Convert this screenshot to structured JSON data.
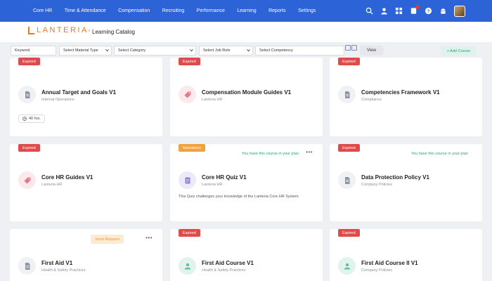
{
  "nav": {
    "items": [
      "Core HR",
      "Time & Attendance",
      "Compensation",
      "Recruiting",
      "Performance",
      "Learning",
      "Reports",
      "Settings"
    ],
    "accent": "#2c63d6"
  },
  "header": {
    "logo_text": "LANTERIA",
    "logo_mark": "®",
    "page_title": "Learning Catalog",
    "brand_color": "#e8762c"
  },
  "filters": {
    "keyword_placeholder": "Keyword",
    "material_type": "Select Material Type",
    "category": "Select Category",
    "job_role": "Select Job Role",
    "competency": "Select Competency",
    "view_label": "View",
    "add_label": "+ Add Course"
  },
  "cards": [
    {
      "badge": "Expired",
      "title": "Annual Target and Goals V1",
      "subtitle": "Internal Operations",
      "icon": "document-icon",
      "hours": "40 hrs."
    },
    {
      "badge": "Expired",
      "title": "Compensation Module Guides V1",
      "subtitle": "Lanteria HR",
      "icon": "tag-icon"
    },
    {
      "badge": "Expired",
      "title": "Competencies Framework V1",
      "subtitle": "Compliance",
      "icon": "document-icon"
    },
    {
      "badge": "Expired",
      "title": "Core HR Guides V1",
      "subtitle": "Lanteria HR",
      "icon": "tag-icon"
    },
    {
      "badge": "Mandatory",
      "title": "Core HR Quiz V1",
      "subtitle": "Lanteria HR",
      "icon": "quiz-icon",
      "plan_note": "You have this course in your plan",
      "description": "This Quiz challenges your knowledge of the Lanteria Core HR System."
    },
    {
      "badge": "Expired",
      "title": "Data Protection Policy V1",
      "subtitle": "Company Policies",
      "icon": "document-icon",
      "plan_note": "You have this course in your plan"
    },
    {
      "action": "Send Request",
      "title": "First Aid V1",
      "subtitle": "Health & Safety Practices",
      "icon": "document-icon"
    },
    {
      "badge": "Expired",
      "title": "First Aid Course V1",
      "subtitle": "Health & Safety Practices",
      "icon": "person-icon"
    },
    {
      "badge": "Expired",
      "title": "First Aid Course II V1",
      "subtitle": "Company Policies",
      "icon": "person-icon"
    }
  ]
}
